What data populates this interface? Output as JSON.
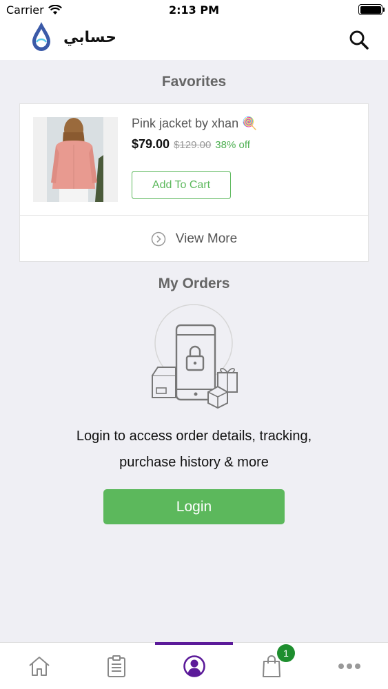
{
  "status_bar": {
    "carrier": "Carrier",
    "time": "2:13 PM"
  },
  "header": {
    "title": "حسابي",
    "brand_color": "#3b5aa8"
  },
  "favorites": {
    "section_title": "Favorites",
    "item": {
      "name": "Pink jacket by xhan 🍭",
      "price": "$79.00",
      "original_price": "$129.00",
      "discount": "38% off",
      "add_to_cart_label": "Add To Cart"
    },
    "view_more_label": "View More"
  },
  "orders": {
    "section_title": "My Orders",
    "message_line1": "Login to access order details, tracking,",
    "message_line2": "purchase history & more",
    "login_label": "Login"
  },
  "tabbar": {
    "active_tab": "account",
    "accent_color": "#5b1a99",
    "cart_badge": "1",
    "tabs": [
      {
        "name": "home",
        "icon": "home-icon"
      },
      {
        "name": "orders",
        "icon": "clipboard-icon"
      },
      {
        "name": "account",
        "icon": "user-circle-icon"
      },
      {
        "name": "cart",
        "icon": "shopping-bag-icon"
      },
      {
        "name": "more",
        "icon": "more-dots-icon"
      }
    ]
  },
  "colors": {
    "accent_green": "#5cb85c",
    "badge_green": "#1e8e2e"
  }
}
